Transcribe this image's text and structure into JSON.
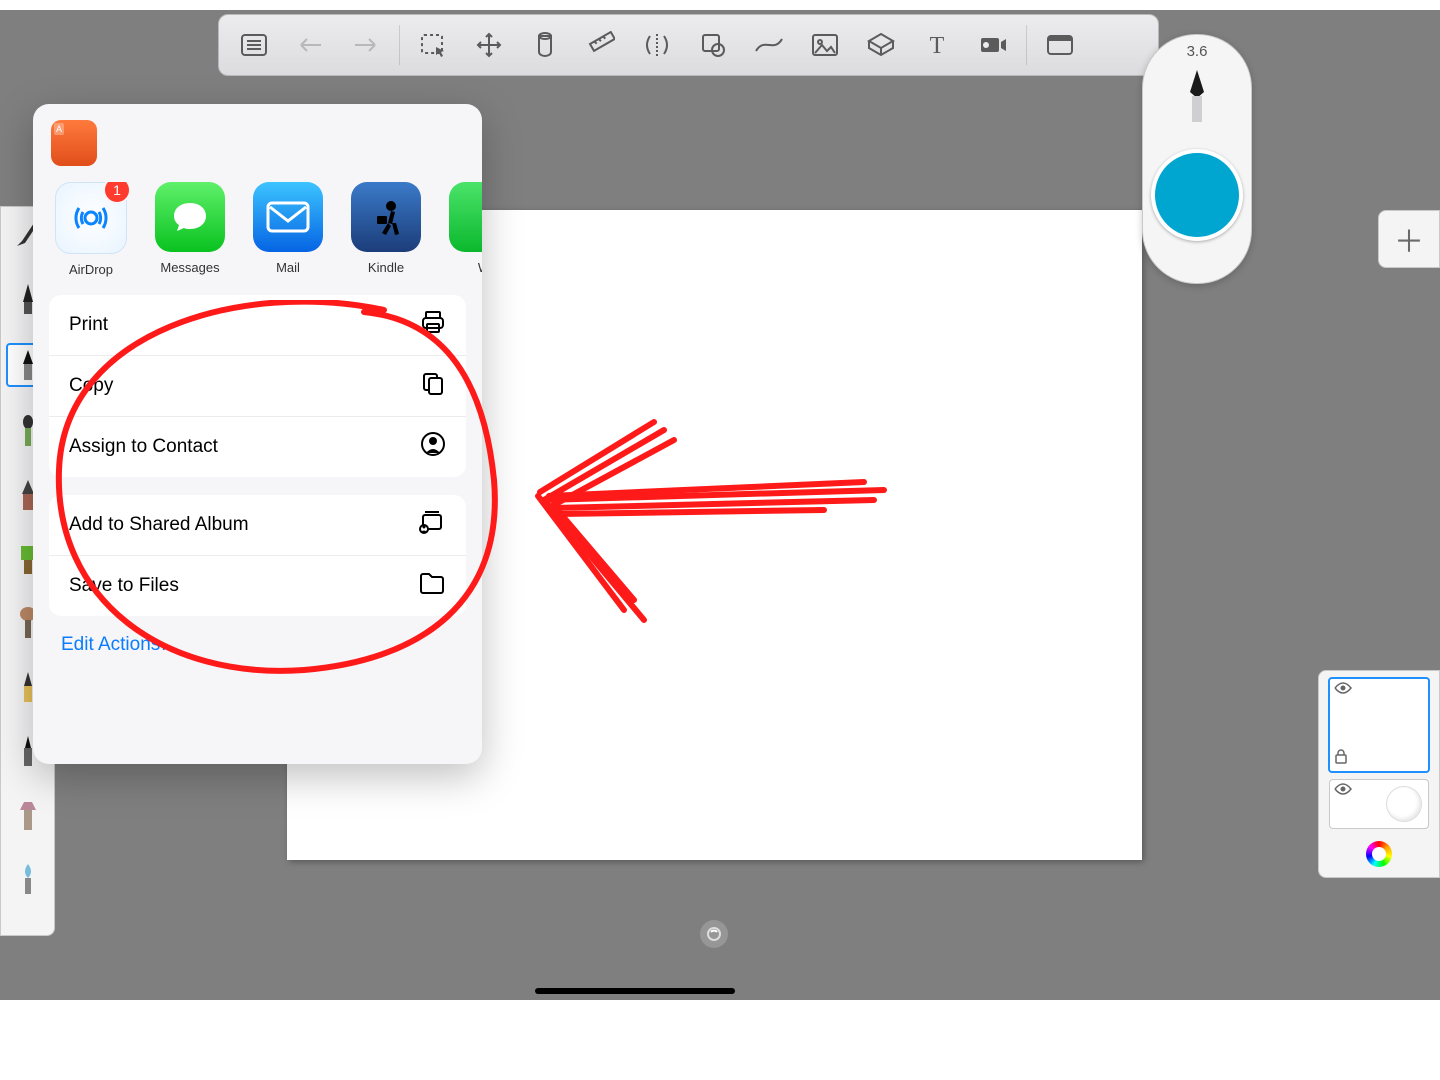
{
  "colors": {
    "accent": "#0a7cff",
    "swatch": "#00a6cf"
  },
  "toolbar": {
    "items": [
      "list",
      "undo",
      "redo",
      "select",
      "transform",
      "fill",
      "ruler",
      "symmetry",
      "shape",
      "stroke",
      "image",
      "perspective",
      "text",
      "timelapse",
      "fullscreen"
    ]
  },
  "puck": {
    "size_label": "3.6"
  },
  "share": {
    "apps": [
      {
        "id": "airdrop",
        "label": "AirDrop",
        "badge": "1"
      },
      {
        "id": "messages",
        "label": "Messages"
      },
      {
        "id": "mail",
        "label": "Mail"
      },
      {
        "id": "kindle",
        "label": "Kindle"
      },
      {
        "id": "whatsapp",
        "label": "W"
      }
    ],
    "actions_group1": [
      {
        "id": "print",
        "label": "Print"
      },
      {
        "id": "copy",
        "label": "Copy"
      },
      {
        "id": "contact",
        "label": "Assign to Contact"
      }
    ],
    "actions_group2": [
      {
        "id": "shared_album",
        "label": "Add to Shared Album"
      },
      {
        "id": "save_files",
        "label": "Save to Files"
      }
    ],
    "edit_actions_label": "Edit Actions…"
  },
  "layers": {
    "plus": "＋"
  }
}
